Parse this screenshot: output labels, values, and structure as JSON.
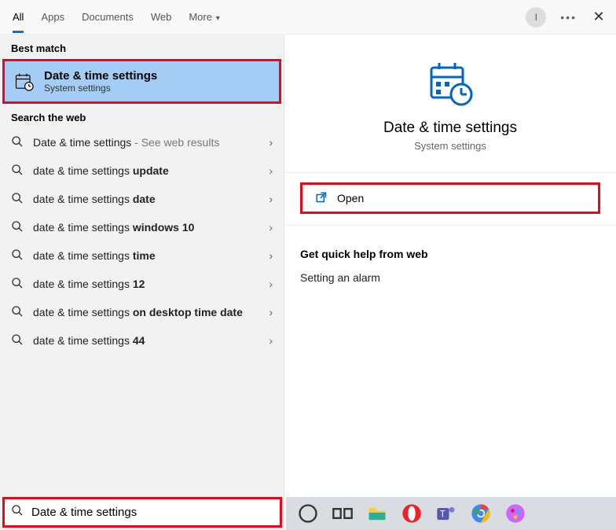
{
  "topbar": {
    "tabs": [
      "All",
      "Apps",
      "Documents",
      "Web",
      "More"
    ],
    "avatar_initial": "I"
  },
  "best_match": {
    "section": "Best match",
    "title": "Date & time settings",
    "subtitle": "System settings"
  },
  "web": {
    "section": "Search the web",
    "items": [
      {
        "prefix": "Date & time settings",
        "bold": "",
        "suffix": " - See web results"
      },
      {
        "prefix": "date & time settings ",
        "bold": "update",
        "suffix": ""
      },
      {
        "prefix": "date & time settings ",
        "bold": "date",
        "suffix": ""
      },
      {
        "prefix": "date & time settings ",
        "bold": "windows 10",
        "suffix": ""
      },
      {
        "prefix": "date & time settings ",
        "bold": "time",
        "suffix": ""
      },
      {
        "prefix": "date & time settings ",
        "bold": "12",
        "suffix": ""
      },
      {
        "prefix": "date & time settings ",
        "bold": "on desktop time date",
        "suffix": ""
      },
      {
        "prefix": "date & time settings ",
        "bold": "44",
        "suffix": ""
      }
    ]
  },
  "detail": {
    "title": "Date & time settings",
    "subtitle": "System settings",
    "open_label": "Open",
    "help_heading": "Get quick help from web",
    "help_link": "Setting an alarm"
  },
  "search": {
    "value": "Date & time settings"
  },
  "taskbar": {
    "items": [
      "cortana",
      "task-view",
      "file-explorer",
      "opera",
      "teams",
      "chrome",
      "paint3d"
    ]
  }
}
